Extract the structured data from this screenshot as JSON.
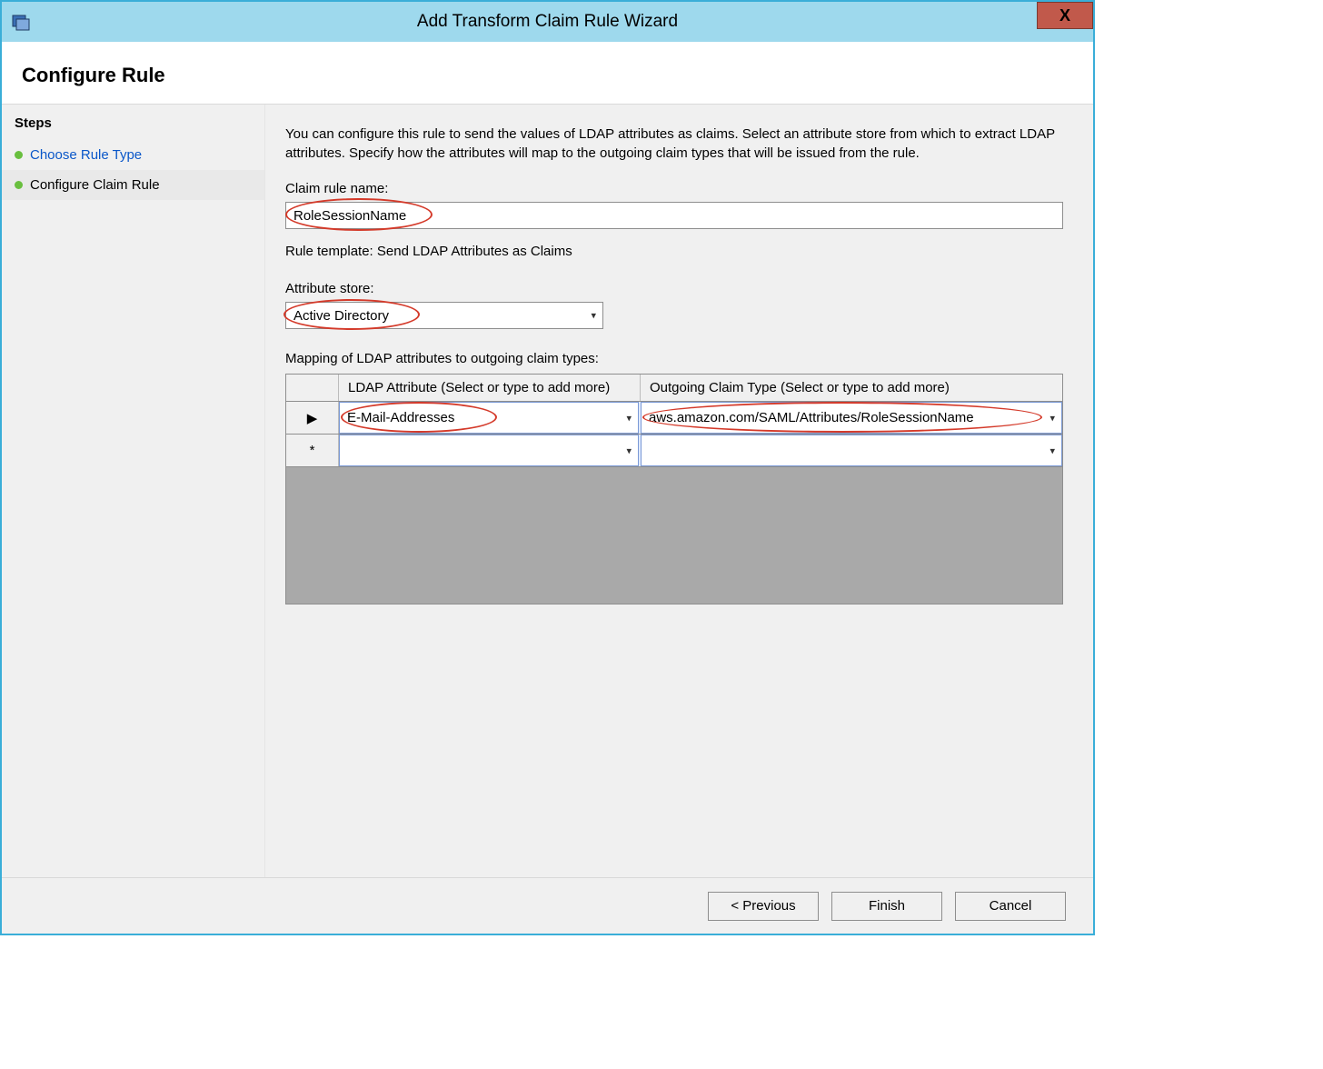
{
  "titlebar": {
    "title": "Add Transform Claim Rule Wizard",
    "close_glyph": "X"
  },
  "header": {
    "title": "Configure Rule"
  },
  "sidebar": {
    "heading": "Steps",
    "items": [
      {
        "label": "Choose Rule Type"
      },
      {
        "label": "Configure Claim Rule"
      }
    ]
  },
  "main": {
    "description": "You can configure this rule to send the values of LDAP attributes as claims. Select an attribute store from which to extract LDAP attributes. Specify how the attributes will map to the outgoing claim types that will be issued from the rule.",
    "claim_rule_name_label": "Claim rule name:",
    "claim_rule_name_value": "RoleSessionName",
    "rule_template_label": "Rule template: Send LDAP Attributes as Claims",
    "attribute_store_label": "Attribute store:",
    "attribute_store_value": "Active Directory",
    "mapping_label": "Mapping of LDAP attributes to outgoing claim types:",
    "grid": {
      "col1_header": "LDAP Attribute (Select or type to add more)",
      "col2_header": "Outgoing Claim Type (Select or type to add more)",
      "rows": [
        {
          "indicator": "▶",
          "ldap": "E-Mail-Addresses",
          "claim": "aws.amazon.com/SAML/Attributes/RoleSessionName"
        },
        {
          "indicator": "*",
          "ldap": "",
          "claim": ""
        }
      ]
    }
  },
  "footer": {
    "previous": "< Previous",
    "finish": "Finish",
    "cancel": "Cancel"
  }
}
